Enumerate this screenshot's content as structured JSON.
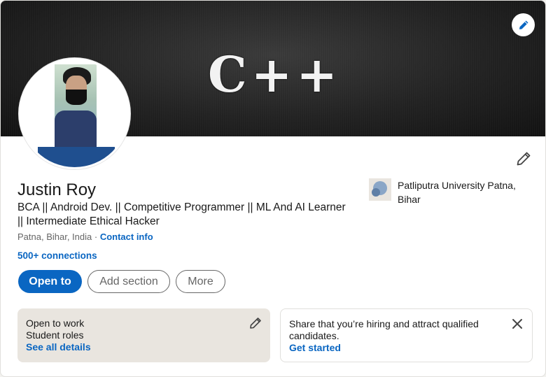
{
  "cover": {
    "text": "C++"
  },
  "profile": {
    "name": "Justin Roy",
    "headline": "BCA || Android Dev. || Competitive Programmer || ML And AI Learner || Intermediate Ethical Hacker",
    "location": "Patna, Bihar, India",
    "separator": " · ",
    "contact_info": "Contact info",
    "connections": "500+ connections"
  },
  "actions": {
    "open_to": "Open to",
    "add_section": "Add section",
    "more": "More"
  },
  "education": {
    "name": "Patliputra University Patna, Bihar"
  },
  "open_to_work": {
    "title": "Open to work",
    "subtitle": "Student roles",
    "link": "See all details"
  },
  "hiring": {
    "bold_text": "Share that you’re hiring",
    "rest_text": " and attract qualified candidates.",
    "link": "Get started"
  },
  "colors": {
    "accent": "#0a66c2",
    "panel_bg": "#e9e5df"
  },
  "icons": {
    "cover_edit": "pencil-icon",
    "intro_edit": "pencil-icon",
    "otw_edit": "pencil-icon",
    "close": "close-icon"
  }
}
